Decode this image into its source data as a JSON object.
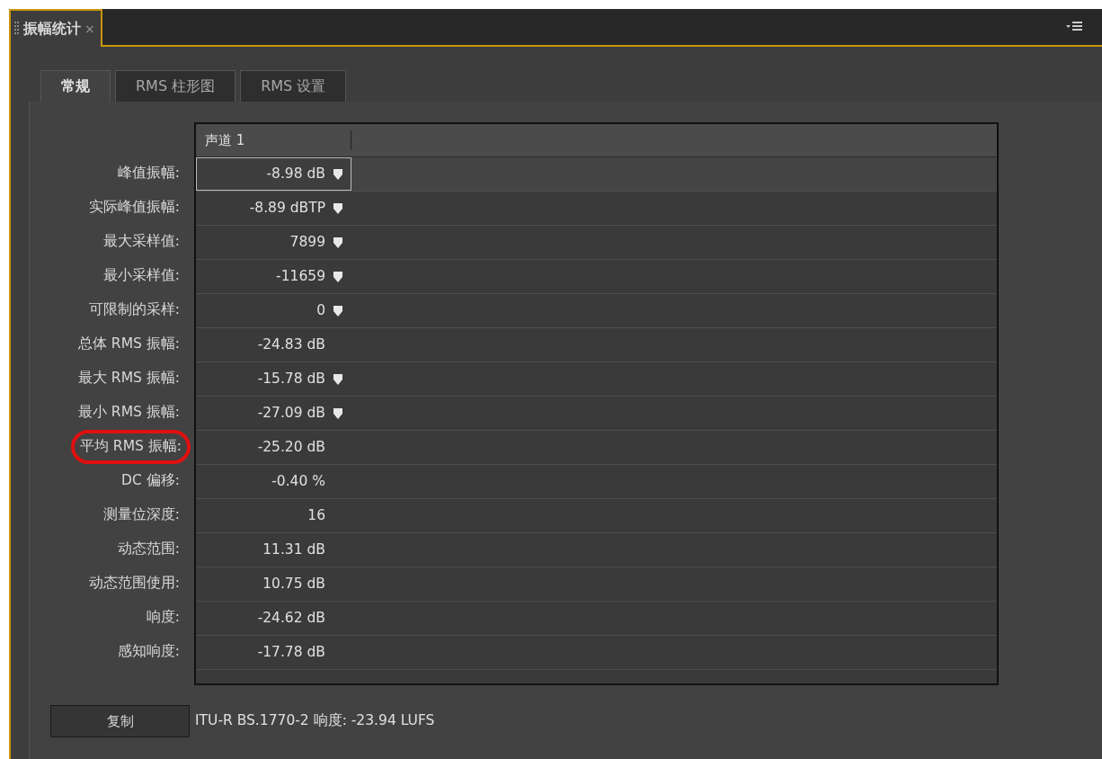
{
  "panel": {
    "title": "振幅统计",
    "close": "×"
  },
  "tabs": [
    {
      "label": "常规",
      "selected": true
    },
    {
      "label": "RMS 柱形图",
      "selected": false
    },
    {
      "label": "RMS 设置",
      "selected": false
    }
  ],
  "table": {
    "columns": [
      "声道 1"
    ],
    "rows": [
      {
        "label": "峰值振幅:",
        "value": "-8.98 dB",
        "marker": true,
        "selected": true,
        "highlighted": false
      },
      {
        "label": "实际峰值振幅:",
        "value": "-8.89 dBTP",
        "marker": true,
        "selected": false,
        "highlighted": false
      },
      {
        "label": "最大采样值:",
        "value": "7899",
        "marker": true,
        "selected": false,
        "highlighted": false
      },
      {
        "label": "最小采样值:",
        "value": "-11659",
        "marker": true,
        "selected": false,
        "highlighted": false
      },
      {
        "label": "可限制的采样:",
        "value": "0",
        "marker": true,
        "selected": false,
        "highlighted": false
      },
      {
        "label": "总体 RMS 振幅:",
        "value": "-24.83 dB",
        "marker": false,
        "selected": false,
        "highlighted": false
      },
      {
        "label": "最大 RMS 振幅:",
        "value": "-15.78 dB",
        "marker": true,
        "selected": false,
        "highlighted": false
      },
      {
        "label": "最小 RMS 振幅:",
        "value": "-27.09 dB",
        "marker": true,
        "selected": false,
        "highlighted": false
      },
      {
        "label": "平均 RMS 振幅:",
        "value": "-25.20 dB",
        "marker": false,
        "selected": false,
        "highlighted": true
      },
      {
        "label": "DC 偏移:",
        "value": "-0.40 %",
        "marker": false,
        "selected": false,
        "highlighted": false
      },
      {
        "label": "测量位深度:",
        "value": "16",
        "marker": false,
        "selected": false,
        "highlighted": false
      },
      {
        "label": "动态范围:",
        "value": "11.31 dB",
        "marker": false,
        "selected": false,
        "highlighted": false
      },
      {
        "label": "动态范围使用:",
        "value": "10.75 dB",
        "marker": false,
        "selected": false,
        "highlighted": false
      },
      {
        "label": "响度:",
        "value": "-24.62 dB",
        "marker": false,
        "selected": false,
        "highlighted": false
      },
      {
        "label": "感知响度:",
        "value": "-17.78 dB",
        "marker": false,
        "selected": false,
        "highlighted": false
      }
    ]
  },
  "copy_button": "复制",
  "loudness_text": "ITU-R BS.1770-2 响度: -23.94 LUFS"
}
